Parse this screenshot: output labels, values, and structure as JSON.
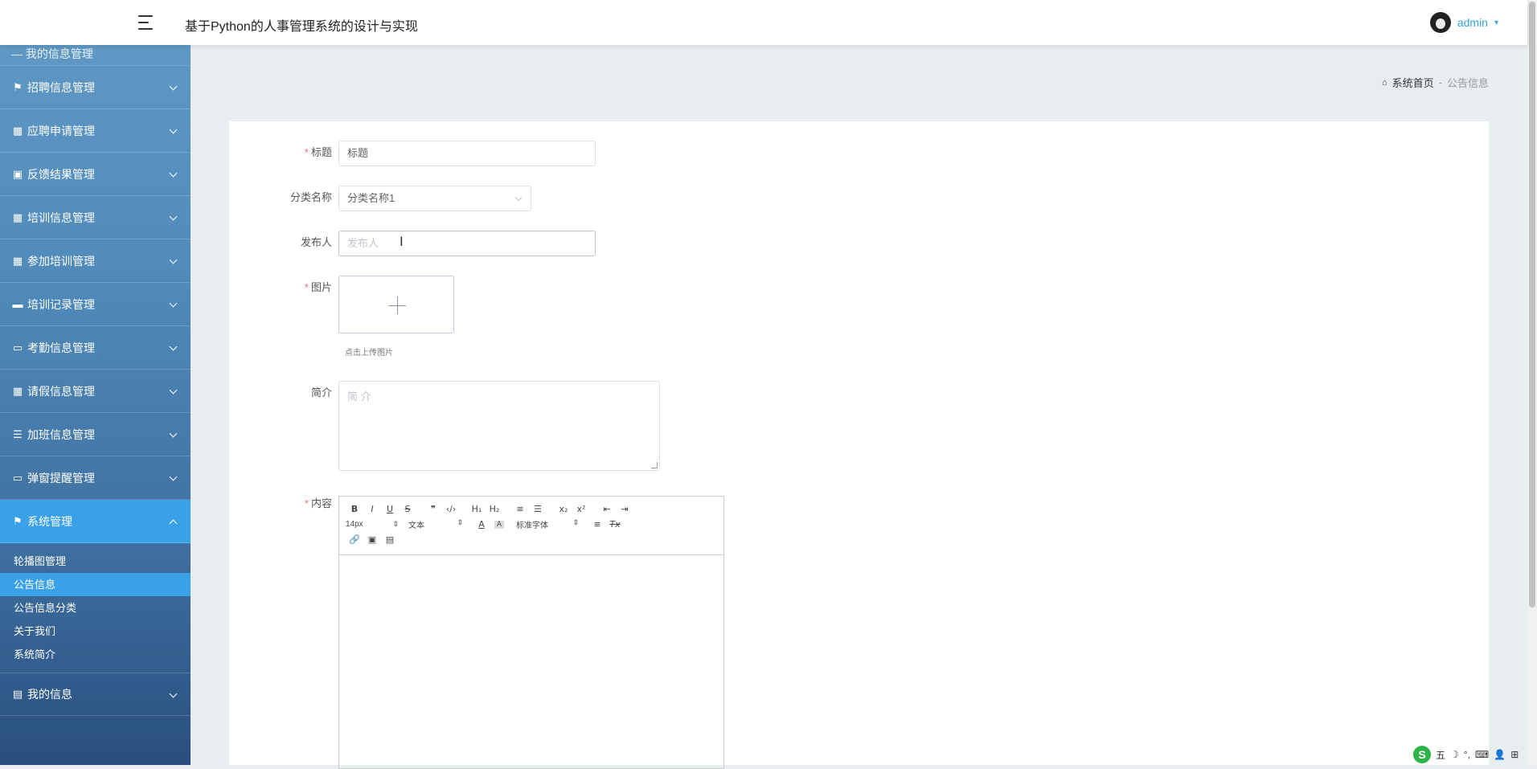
{
  "header": {
    "title": "基于Python的人事管理系统的设计与实现",
    "user_name": "admin",
    "user_caret": "▾"
  },
  "sidebar": {
    "cut_item": "— 我的信息管理",
    "items": [
      {
        "label": "招聘信息管理",
        "icon": "sign-icon",
        "glyph": "⚑"
      },
      {
        "label": "应聘申请管理",
        "icon": "grid-icon",
        "glyph": "▦"
      },
      {
        "label": "反馈结果管理",
        "icon": "briefcase-icon",
        "glyph": "▣"
      },
      {
        "label": "培训信息管理",
        "icon": "grid-icon",
        "glyph": "▦"
      },
      {
        "label": "参加培训管理",
        "icon": "grid-icon",
        "glyph": "▦"
      },
      {
        "label": "培训记录管理",
        "icon": "comment-icon",
        "glyph": "▬"
      },
      {
        "label": "考勤信息管理",
        "icon": "ticket-icon",
        "glyph": "▭"
      },
      {
        "label": "请假信息管理",
        "icon": "grid-icon",
        "glyph": "▦"
      },
      {
        "label": "加班信息管理",
        "icon": "list-icon",
        "glyph": "☰"
      },
      {
        "label": "弹窗提醒管理",
        "icon": "monitor-icon",
        "glyph": "▭"
      }
    ],
    "system": {
      "label": "系统管理",
      "icon": "flag-icon",
      "glyph": "⚑"
    },
    "sub_items": [
      "轮播图管理",
      "公告信息",
      "公告信息分类",
      "关于我们",
      "系统简介"
    ],
    "sub_active": "公告信息",
    "my_info": {
      "label": "我的信息",
      "icon": "card-icon",
      "glyph": "▤"
    }
  },
  "breadcrumb": {
    "home": "系统首页",
    "separator": "-",
    "current": "公告信息"
  },
  "form": {
    "title_label": "标题",
    "title_value": "标题",
    "category_label": "分类名称",
    "category_value": "分类名称1",
    "publisher_label": "发布人",
    "publisher_placeholder": "发布人",
    "image_label": "图片",
    "image_hint": "点击上传图片",
    "intro_label": "简介",
    "intro_placeholder": "简 介",
    "content_label": "内容",
    "required_mark": "*"
  },
  "editor": {
    "font_size": "14px",
    "header_select": "文本",
    "font_family": "标准字体",
    "buttons_row1": [
      {
        "glyph": "B",
        "name": "bold-button"
      },
      {
        "glyph": "I",
        "name": "italic-button"
      },
      {
        "glyph": "U",
        "name": "underline-button"
      },
      {
        "glyph": "S",
        "name": "strike-button"
      },
      {
        "glyph": "❞",
        "name": "blockquote-button"
      },
      {
        "glyph": "‹/›",
        "name": "code-block-button"
      },
      {
        "glyph": "H₁",
        "name": "h1-button"
      },
      {
        "glyph": "H₂",
        "name": "h2-button"
      },
      {
        "glyph": "≡",
        "name": "ordered-list-button"
      },
      {
        "glyph": "☰",
        "name": "bullet-list-button"
      },
      {
        "glyph": "x₂",
        "name": "subscript-button"
      },
      {
        "glyph": "x²",
        "name": "superscript-button"
      },
      {
        "glyph": "⇤",
        "name": "outdent-button"
      },
      {
        "glyph": "⇥",
        "name": "indent-button"
      }
    ],
    "buttons_row3": [
      {
        "glyph": "🔗",
        "name": "link-button"
      },
      {
        "glyph": "▣",
        "name": "image-button"
      },
      {
        "glyph": "▤",
        "name": "video-button"
      }
    ],
    "color_glyph": "A",
    "background_glyph": "A",
    "align_glyph": "≡",
    "clean_glyph": "Tx"
  },
  "tray": {
    "ime_logo": "S",
    "ime_text": "五",
    "moon": "☽",
    "punct": "°,",
    "keyboard": "⌨",
    "person": "👤",
    "grid": "⊞"
  },
  "colors": {
    "accent": "#3aa1e8",
    "user": "#36a3d8",
    "required": "#f56c6c"
  }
}
